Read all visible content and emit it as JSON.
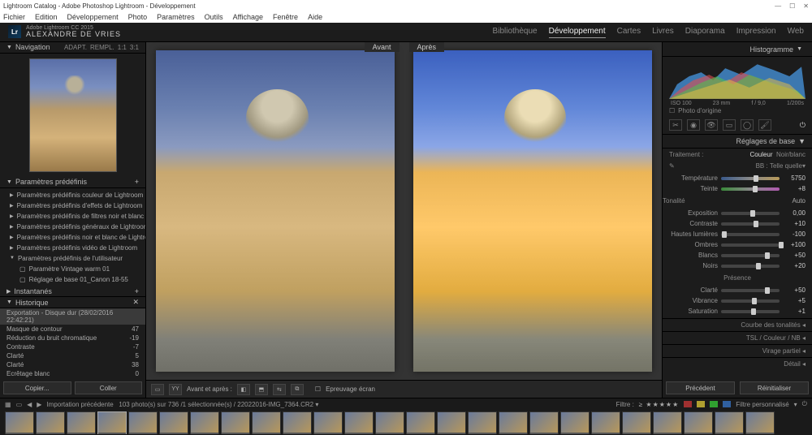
{
  "window": {
    "title": "Lightroom Catalog - Adobe Photoshop Lightroom - Développement"
  },
  "menu": [
    "Fichier",
    "Edition",
    "Développement",
    "Photo",
    "Paramètres",
    "Outils",
    "Affichage",
    "Fenêtre",
    "Aide"
  ],
  "branding": {
    "sub": "Adobe Lightroom CC 2015",
    "main": "ALEXANDRE DE VRIES"
  },
  "modules": [
    "Bibliothèque",
    "Développement",
    "Cartes",
    "Livres",
    "Diaporama",
    "Impression",
    "Web"
  ],
  "activeModule": "Développement",
  "left": {
    "nav": {
      "title": "Navigation",
      "opts": [
        "ADAPT.",
        "REMPL.",
        "1:1",
        "3:1"
      ]
    },
    "presets": {
      "title": "Paramètres prédéfinis",
      "items": [
        "Paramètres prédéfinis couleur de Lightroom",
        "Paramètres prédéfinis d'effets de Lightroom",
        "Paramètres prédéfinis de filtres noir et blanc d…",
        "Paramètres prédéfinis généraux de Lightroom",
        "Paramètres prédéfinis noir et blanc de Lightro…",
        "Paramètres prédéfinis vidéo de Lightroom",
        "Paramètres prédéfinis de l'utilisateur"
      ],
      "user": [
        "Paramètre Vintage warm 01",
        "Réglage de base 01_Canon 18-55"
      ]
    },
    "snapshots": {
      "title": "Instantanés"
    },
    "history": {
      "title": "Historique",
      "highlight": "Exportation - Disque dur (28/02/2016 22:42:21)",
      "rows": [
        {
          "l": "Masque de contour",
          "v": "47"
        },
        {
          "l": "Réduction du bruit chromatique",
          "v": "-19"
        },
        {
          "l": "Contraste",
          "v": "-7"
        },
        {
          "l": "Clarté",
          "v": "5"
        },
        {
          "l": "Clarté",
          "v": "38"
        },
        {
          "l": "Ecrêtage blanc",
          "v": "0"
        }
      ]
    },
    "copy": "Copier...",
    "paste": "Coller"
  },
  "center": {
    "before": "Avant",
    "after": "Après",
    "toolbar": {
      "compare": "Avant et après :",
      "softproof": "Epreuvage écran"
    }
  },
  "right": {
    "histogram": {
      "title": "Histogramme",
      "meta": [
        "ISO 100",
        "23 mm",
        "f / 9,0",
        "1/200s"
      ]
    },
    "origin": "Photo d'origine",
    "basic": {
      "title": "Réglages de base",
      "treatment": {
        "label": "Traitement :",
        "color": "Couleur",
        "bw": "Noir/blanc"
      },
      "wb": {
        "label": "BB :",
        "value": "Telle quelle"
      },
      "temp": {
        "label": "Température",
        "value": "5750",
        "pos": 55
      },
      "tint": {
        "label": "Teinte",
        "value": "+8",
        "pos": 54
      },
      "tone": "Tonalité",
      "auto": "Auto",
      "exposure": {
        "label": "Exposition",
        "value": "0,00",
        "pos": 50
      },
      "contrast": {
        "label": "Contraste",
        "value": "+10",
        "pos": 55
      },
      "highlights": {
        "label": "Hautes lumières",
        "value": "-100",
        "pos": 2
      },
      "shadows": {
        "label": "Ombres",
        "value": "+100",
        "pos": 98
      },
      "whites": {
        "label": "Blancs",
        "value": "+50",
        "pos": 75
      },
      "blacks": {
        "label": "Noirs",
        "value": "+20",
        "pos": 60
      },
      "presence": "Présence",
      "clarity": {
        "label": "Clarté",
        "value": "+50",
        "pos": 75
      },
      "vibrance": {
        "label": "Vibrance",
        "value": "+5",
        "pos": 53
      },
      "saturation": {
        "label": "Saturation",
        "value": "+1",
        "pos": 51
      }
    },
    "panels": [
      "Courbe des tonalités",
      "TSL / Couleur / NB",
      "Virage partiel",
      "Détail"
    ],
    "prev": "Précédent",
    "reset": "Réinitialiser"
  },
  "filmstrip": {
    "source": "Importation précédente",
    "count": "103 photo(s) sur 736 /1 sélectionnée(s) /",
    "file": "22022016-IMG_7364.CR2",
    "filterLabel": "Filtre :",
    "customFilter": "Filtre personnalisé"
  }
}
